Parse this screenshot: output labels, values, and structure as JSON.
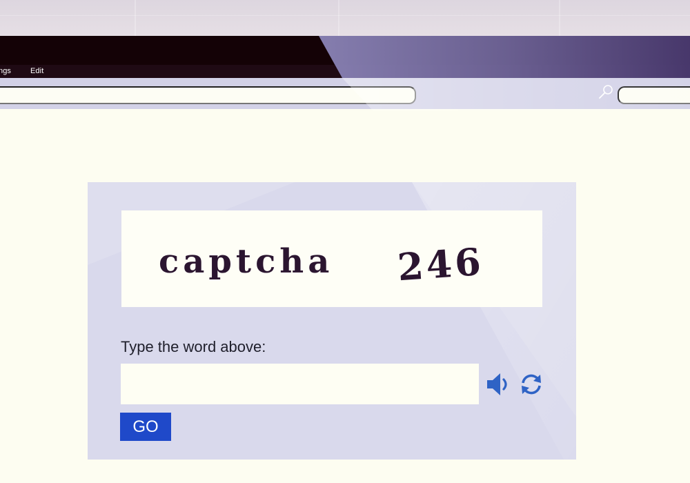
{
  "browser": {
    "menu": {
      "settings_label": "ngs",
      "edit_label": "Edit"
    },
    "address_bar": {
      "value": ""
    },
    "search_box": {
      "value": ""
    }
  },
  "captcha": {
    "image_text": {
      "word": "captcha",
      "number": "246"
    },
    "prompt": "Type the word above:",
    "answer_value": "",
    "go_label": "GO",
    "icons": {
      "audio": "speaker-icon",
      "refresh": "refresh-icon"
    }
  },
  "colors": {
    "accent": "#1f49c9",
    "icon_blue": "#2f63c5",
    "captcha_text": "#2b1530",
    "panel_bg": "#dddded",
    "page_bg": "#fdfdf1"
  }
}
